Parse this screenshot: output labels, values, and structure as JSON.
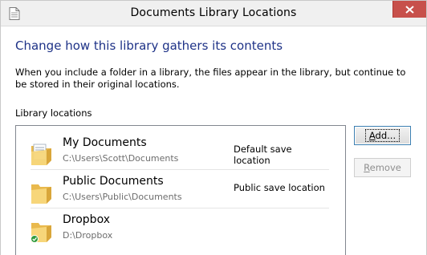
{
  "window": {
    "title": "Documents Library Locations",
    "close_glyph": "close-icon"
  },
  "heading": "Change how this library gathers its contents",
  "description": "When you include a folder in a library, the files appear in the library, but continue to be stored in their original locations.",
  "locations_label": "Library locations",
  "locations": [
    {
      "name": "My Documents",
      "path": "C:\\Users\\Scott\\Documents",
      "status": "Default save location",
      "icon": "folder-documents-icon"
    },
    {
      "name": "Public Documents",
      "path": "C:\\Users\\Public\\Documents",
      "status": "Public save location",
      "icon": "folder-icon"
    },
    {
      "name": "Dropbox",
      "path": "D:\\Dropbox",
      "status": "",
      "icon": "folder-sync-icon"
    }
  ],
  "buttons": {
    "add_mnemonic": "A",
    "add_rest": "dd...",
    "remove_mnemonic": "R",
    "remove_rest": "emove"
  },
  "colors": {
    "heading": "#1e3287",
    "close_button": "#c7504b",
    "folder": "#f5cf6d",
    "focus_border": "#3c7fb1"
  }
}
